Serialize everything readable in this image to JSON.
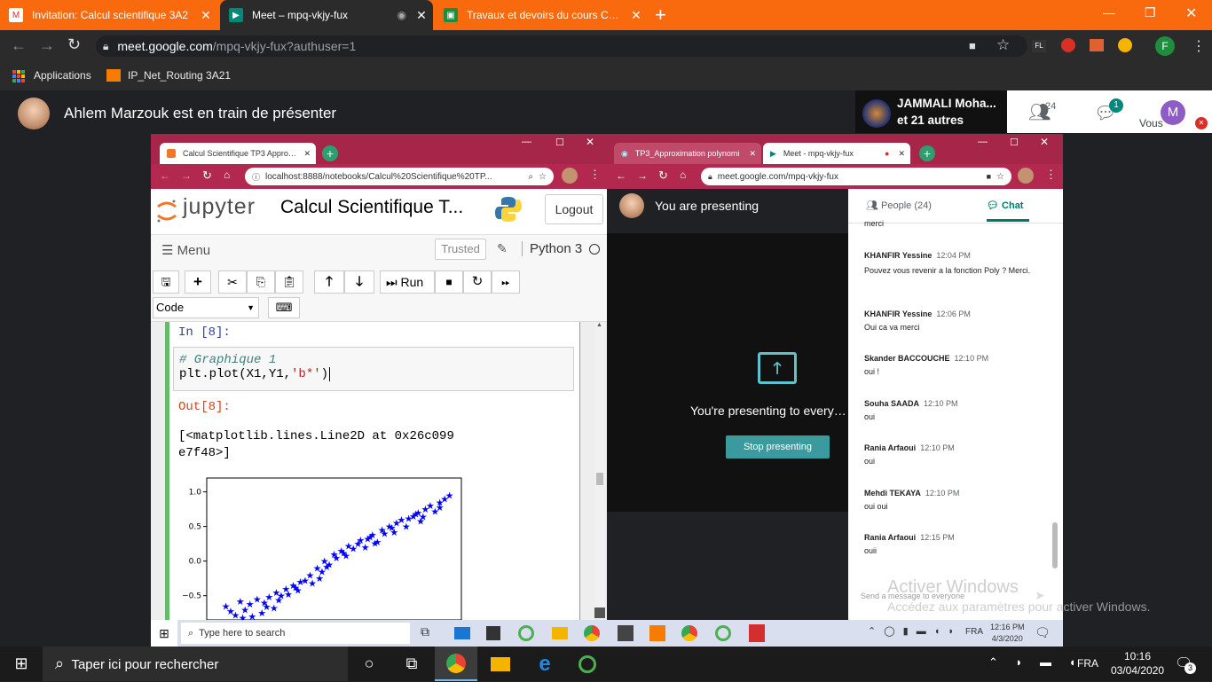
{
  "browser": {
    "tabs": [
      {
        "title": "Invitation: Calcul scientifique 3A2",
        "icon": "gmail-icon",
        "color": "#d93025"
      },
      {
        "title": "Meet – mpq-vkjy-fux",
        "icon": "meet-icon",
        "color": "#00897b"
      },
      {
        "title": "Travaux et devoirs du cours Calcu",
        "icon": "classroom-icon",
        "color": "#1e8e3e"
      }
    ],
    "url_host": "meet.google.com",
    "url_path": "/mpq-vkjy-fux?authuser=1",
    "bookmarks": [
      {
        "label": "Applications",
        "icon": "apps-grid-icon"
      },
      {
        "label": "IP_Net_Routing 3A21",
        "icon": "bookmark-icon"
      }
    ],
    "profile_initial": "F"
  },
  "meet": {
    "presenting_text": "Ahlem Marzouk est en train de présenter",
    "participant_name": "JAMMALI Moha...",
    "participant_others": "et 21 autres",
    "people_count": "24",
    "chat_badge": "1",
    "self_label": "Vous",
    "self_initial": "M"
  },
  "jupyter_window": {
    "tab_title": "Calcul Scientifique TP3 Approxim",
    "url": "localhost:8888/notebooks/Calcul%20Scientifique%20TP...",
    "logo_text": "jupyter",
    "notebook_title": "Calcul Scientifique T...",
    "logout": "Logout",
    "menu": "Menu",
    "trusted": "Trusted",
    "kernel": "Python 3",
    "run_label": "Run",
    "cell_type": "Code",
    "in_prompt": "In [8]:",
    "code_comment": "# Graphique 1",
    "code_line_pre": "plt.plot(X1,Y1,",
    "code_line_str": "'b*'",
    "code_line_post": ")",
    "out_prompt": "Out[8]:",
    "output_line1": "[<matplotlib.lines.Line2D at 0x26c099",
    "output_line2": "e7f48>]",
    "yticks": [
      "1.0",
      "0.5",
      "0.0",
      "−0.5"
    ]
  },
  "chart_data": {
    "type": "scatter",
    "marker": "*",
    "color": "#0000ff",
    "ylim": [
      -0.85,
      1.2
    ],
    "xlim": [
      0,
      1
    ],
    "yticks": [
      1.0,
      0.5,
      0.0,
      -0.5
    ],
    "series": [
      {
        "x": [
          0.05,
          0.07,
          0.09,
          0.11,
          0.13,
          0.15,
          0.16,
          0.18,
          0.2,
          0.21,
          0.23,
          0.25,
          0.26,
          0.28,
          0.3,
          0.31,
          0.33,
          0.35,
          0.36,
          0.38,
          0.4,
          0.41,
          0.43,
          0.45,
          0.46,
          0.48,
          0.5,
          0.51,
          0.53,
          0.55,
          0.56,
          0.58,
          0.6,
          0.61,
          0.63,
          0.65,
          0.66,
          0.68,
          0.7,
          0.71,
          0.73,
          0.75,
          0.76,
          0.78,
          0.8,
          0.81,
          0.83,
          0.85,
          0.86,
          0.88,
          0.9,
          0.92,
          0.94,
          0.96,
          0.98,
          0.12,
          0.22,
          0.34,
          0.44,
          0.54,
          0.64,
          0.74,
          0.84,
          0.94,
          0.27,
          0.47,
          0.67,
          0.87
        ],
        "y": [
          -0.65,
          -0.72,
          -0.78,
          -0.58,
          -0.7,
          -0.62,
          -0.8,
          -0.55,
          -0.75,
          -0.6,
          -0.52,
          -0.68,
          -0.45,
          -0.5,
          -0.4,
          -0.48,
          -0.35,
          -0.42,
          -0.3,
          -0.28,
          -0.2,
          -0.32,
          -0.1,
          -0.15,
          0.0,
          -0.05,
          0.1,
          0.05,
          0.15,
          0.08,
          0.22,
          0.18,
          0.25,
          0.3,
          0.2,
          0.35,
          0.38,
          0.28,
          0.45,
          0.4,
          0.5,
          0.42,
          0.55,
          0.6,
          0.5,
          0.62,
          0.65,
          0.7,
          0.58,
          0.75,
          0.8,
          0.72,
          0.85,
          0.9,
          0.95,
          -0.82,
          -0.66,
          -0.38,
          -0.25,
          0.12,
          0.32,
          0.48,
          0.68,
          0.78,
          -0.56,
          -0.08,
          0.26,
          0.64
        ]
      }
    ]
  },
  "meet_window": {
    "tab1": "TP3_Approximation polynomi",
    "tab2": "Meet - mpq-vkjy-fux",
    "url": "meet.google.com/mpq-vkjy-fux",
    "you_presenting": "You are presenting",
    "presenting_to": "You're presenting to everyone",
    "stop": "Stop presenting",
    "people_tab": "People (24)",
    "chat_tab": "Chat",
    "chat_top_cut": "merci",
    "messages": [
      {
        "author": "KHANFIR Yessine",
        "time": "12:04 PM",
        "text": "Pouvez vous revenir a la fonction Poly ? Merci."
      },
      {
        "author": "KHANFIR Yessine",
        "time": "12:06 PM",
        "text": "Oui ca va merci"
      },
      {
        "author": "Skander BACCOUCHE",
        "time": "12:10 PM",
        "text": "oui !"
      },
      {
        "author": "Souha SAADA",
        "time": "12:10 PM",
        "text": "oui"
      },
      {
        "author": "Rania Arfaoui",
        "time": "12:10 PM",
        "text": "oui"
      },
      {
        "author": "Mehdi TEKAYA",
        "time": "12:10 PM",
        "text": "oui oui"
      },
      {
        "author": "Rania Arfaoui",
        "time": "12:15 PM",
        "text": "ouii"
      }
    ],
    "send_placeholder": "Send a message to everyone"
  },
  "watermark": {
    "title": "Activer Windows",
    "sub": "Accédez aux paramètres pour activer Windows."
  },
  "inner_taskbar": {
    "search": "Type here to search",
    "lang": "FRA",
    "time": "12:16 PM",
    "date": "4/3/2020"
  },
  "taskbar": {
    "search": "Taper ici pour rechercher",
    "lang": "FRA",
    "time": "10:16",
    "date": "03/04/2020",
    "notif_count": "3"
  }
}
